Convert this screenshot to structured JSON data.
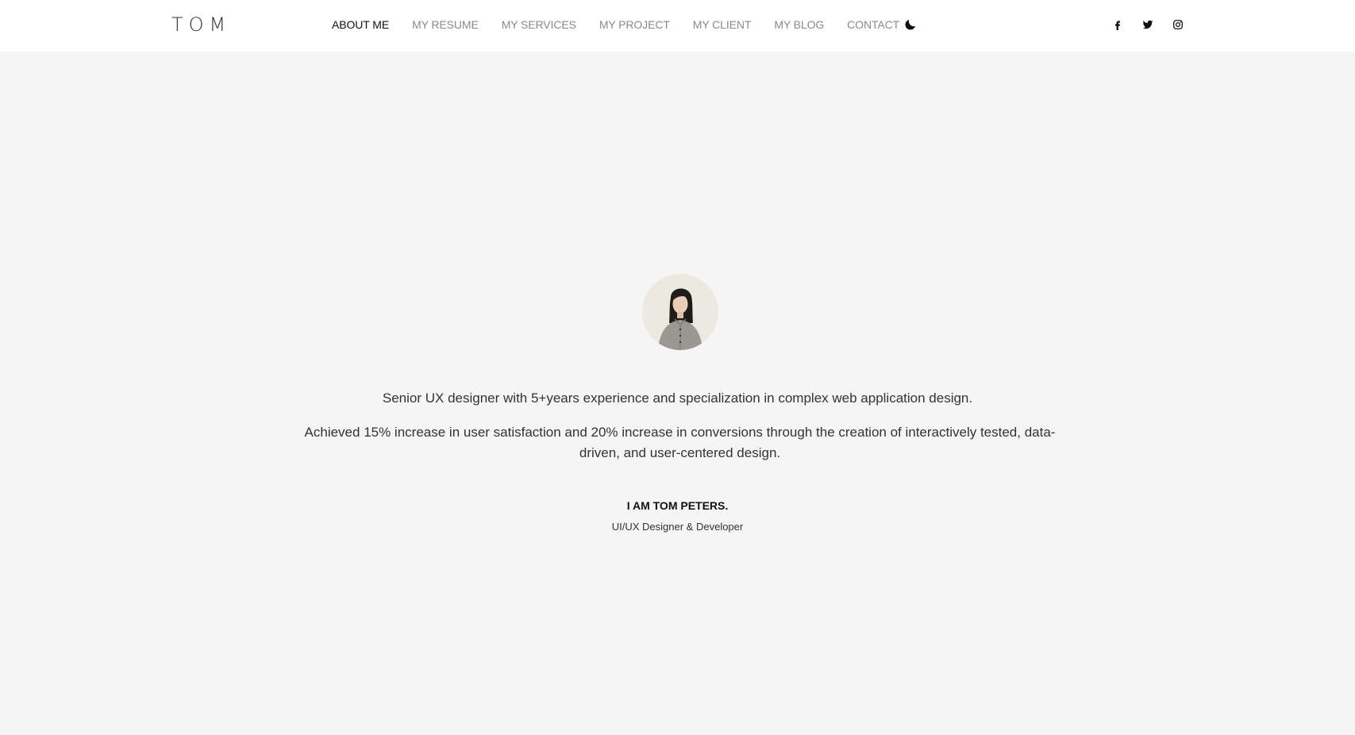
{
  "header": {
    "logo": "TOM",
    "nav": [
      {
        "label": "ABOUT ME",
        "active": true
      },
      {
        "label": "MY RESUME",
        "active": false
      },
      {
        "label": "MY SERVICES",
        "active": false
      },
      {
        "label": "MY PROJECT",
        "active": false
      },
      {
        "label": "MY CLIENT",
        "active": false
      },
      {
        "label": "MY BLOG",
        "active": false
      },
      {
        "label": "CONTACT",
        "active": false
      }
    ],
    "theme_toggle_icon": "moon-icon",
    "social_icons": [
      "facebook-icon",
      "twitter-icon",
      "instagram-icon"
    ]
  },
  "hero": {
    "avatar_icon": "profile-photo",
    "intro_line_1": "Senior UX designer with 5+years experience and specialization in complex web application design.",
    "intro_line_2": "Achieved 15% increase in user satisfaction and 20% increase in conversions through the creation of interactively tested, data-driven, and user-centered design.",
    "name": "I AM TOM PETERS.",
    "role": "UI/UX Designer & Developer"
  },
  "colors": {
    "header_bg": "#ffffff",
    "page_bg": "#f5f5f5",
    "nav_active": "#111111",
    "nav_inactive": "#8a8a8a"
  }
}
